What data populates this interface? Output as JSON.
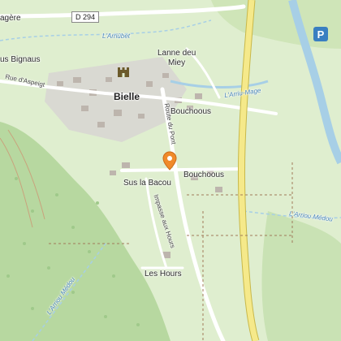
{
  "map": {
    "labels": {
      "d294": "D 294",
      "ariuebet": "L'Arriùbet",
      "lanne": "Lanne deu",
      "miey": "Miey",
      "bignaus": "us Bignaus",
      "agere": "agère",
      "aspeigt": "Rue d'Aspeigt",
      "bielle": "Bielle",
      "bouchoous1": "Bouchoous",
      "arriumage": "L'Arriu-Mage",
      "routedupont": "Route du Pont",
      "bouchoous2": "Bouchoous",
      "suslabacou": "Sus la Bacou",
      "impasse": "Impasse aux Hours",
      "arriumedou1": "L'Arriou Médou",
      "arriumedou2": "L'Arriou Médou",
      "leshours": "Les Hours"
    },
    "icons": {
      "marker": "location-marker-icon",
      "castle": "castle-icon",
      "parking": "parking-icon"
    },
    "colors": {
      "meadow": "#dfeecf",
      "forest": "#b7d8a0",
      "water": "#a7cfe6",
      "main_road": "#f5e98a",
      "marker": "#f08a2a"
    }
  }
}
